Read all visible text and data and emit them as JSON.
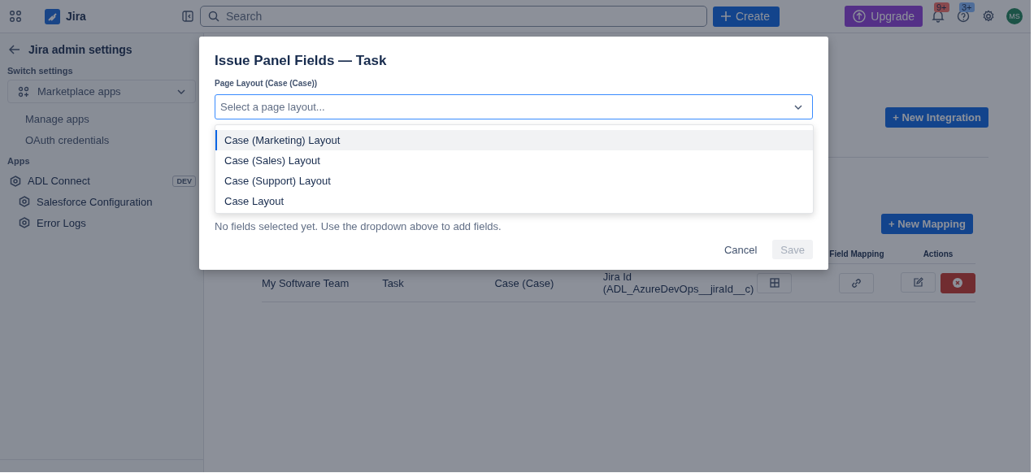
{
  "topbar": {
    "app_name": "Jira",
    "search": {
      "placeholder": "Search"
    },
    "create_label": "Create",
    "upgrade_label": "Upgrade",
    "notifications_badge": "9+",
    "help_badge": "3+",
    "avatar_initials": "MS"
  },
  "sidebar": {
    "title": "Jira admin settings",
    "switch_label": "Switch settings",
    "switch_value": "Marketplace apps",
    "links": [
      {
        "label": "Manage apps"
      },
      {
        "label": "OAuth credentials"
      }
    ],
    "apps_heading": "Apps",
    "apps": [
      {
        "label": "ADL Connect",
        "badge": "DEV",
        "children": [
          {
            "label": "Salesforce Configuration"
          },
          {
            "label": "Error Logs"
          }
        ]
      }
    ]
  },
  "main": {
    "new_integration_label": "+ New Integration",
    "new_mapping_label": "+ New Mapping",
    "table": {
      "columns": [
        {
          "label": "Field Mapping"
        },
        {
          "label": "Actions"
        }
      ],
      "rows": [
        {
          "cells": [
            "My Software Team",
            "Task",
            "Case (Case)",
            "Jira Id (ADL_AzureDevOps__jiraId__c)"
          ]
        }
      ]
    }
  },
  "modal": {
    "title": "Issue Panel Fields — Task",
    "field_label": "Page Layout (Case (Case))",
    "placeholder": "Select a page layout...",
    "expanded": true,
    "options": [
      {
        "label": "Case (Marketing) Layout",
        "selected": true
      },
      {
        "label": "Case (Sales) Layout",
        "selected": false
      },
      {
        "label": "Case (Support) Layout",
        "selected": false
      },
      {
        "label": "Case Layout",
        "selected": false
      }
    ],
    "empty_message": "No fields selected yet. Use the dropdown above to add fields.",
    "buttons": [
      {
        "label": "Cancel",
        "kind": "subtle",
        "disabled": false
      },
      {
        "label": "Save",
        "kind": "primary",
        "disabled": true
      }
    ]
  }
}
